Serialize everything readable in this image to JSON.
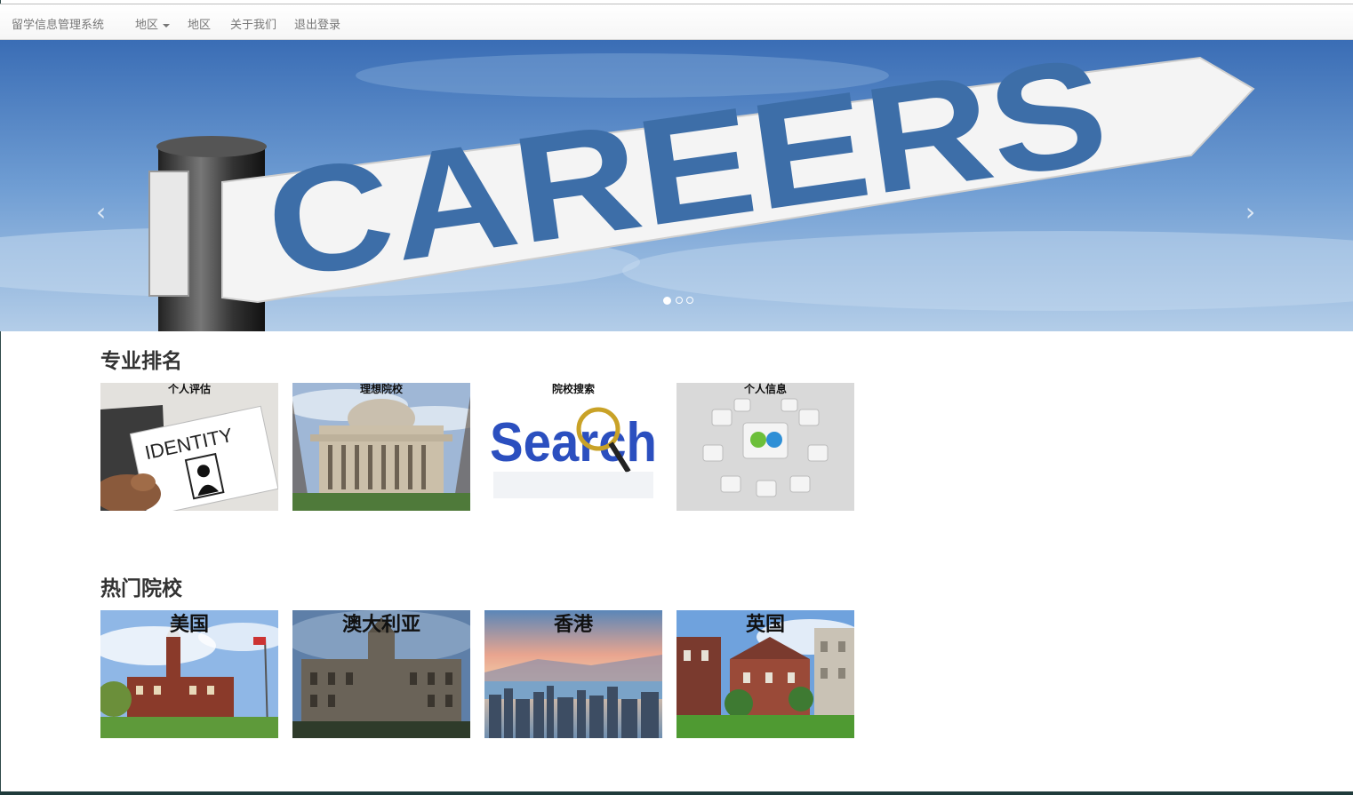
{
  "navbar": {
    "brand": "留学信息管理系统",
    "dropdown_label": "地区",
    "region_link": "地区",
    "about_link": "关于我们",
    "logout_link": "退出登录"
  },
  "carousel": {
    "slide_text": "CAREERS",
    "prev_glyph": "‹",
    "next_glyph": "›",
    "slide_count": 3,
    "active_slide": 1
  },
  "ranking": {
    "title": "专业排名",
    "cards": [
      {
        "label": "个人评估",
        "image_text": "IDENTITY"
      },
      {
        "label": "理想院校"
      },
      {
        "label": "院校搜索",
        "image_text": "Search"
      },
      {
        "label": "个人信息"
      }
    ]
  },
  "schools": {
    "title": "热门院校",
    "cards": [
      {
        "label": "美国"
      },
      {
        "label": "澳大利亚"
      },
      {
        "label": "香港"
      },
      {
        "label": "英国"
      }
    ]
  },
  "colors": {
    "nav_text": "#777777",
    "sky_blue": "#4a7fc0",
    "sign_text_blue": "#3d6ea8",
    "title_text": "#333333"
  }
}
